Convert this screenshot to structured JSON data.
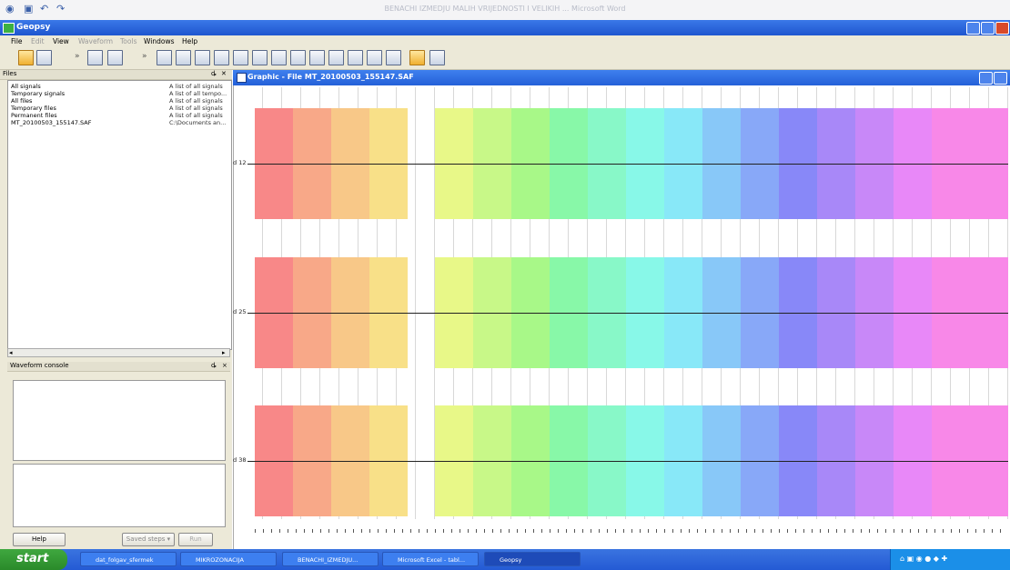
{
  "word_window": {
    "title": "BENACHI IZMEDJU MALIH VRIJEDNOSTI I VELIKIH ... Microsoft Word"
  },
  "geopsy": {
    "title": "Geopsy",
    "menu": [
      "File",
      "Edit",
      "View",
      "Waveform",
      "Tools",
      "Windows",
      "Help"
    ],
    "toolbar_icons": [
      "open-folder-icon",
      "save-icon",
      "table-icon",
      "view-icon",
      "graphic-icon",
      "map-icon",
      "chart-icon",
      "grid-icon",
      "signal-icon",
      "spectrum-icon",
      "filter-icon",
      "rotate-icon",
      "pick-icon",
      "fk-icon",
      "hv-icon",
      "structure-icon",
      "orange-icon",
      "export-icon"
    ]
  },
  "files_panel": {
    "title": "Files",
    "rows": [
      {
        "name": "All signals",
        "desc": "A list of all signals"
      },
      {
        "name": "Temporary signals",
        "desc": "A list of all tempo..."
      },
      {
        "name": "All files",
        "desc": "A list of all signals"
      },
      {
        "name": "Temporary files",
        "desc": "A list of all signals"
      },
      {
        "name": "Permanent files",
        "desc": "A list of all signals"
      },
      {
        "name": "MT_20100503_155147.SAF",
        "desc": "C:\\Documents an..."
      }
    ]
  },
  "waveform_console": {
    "title": "Waveform console",
    "help_label": "Help",
    "saved_label": "Saved steps",
    "run_label": "Run"
  },
  "graphic_window": {
    "title": "Graphic - File MT_20100503_155147.SAF",
    "traces": [
      {
        "label": "d 12"
      },
      {
        "label": "d 25"
      },
      {
        "label": "d 38"
      }
    ]
  },
  "taskbar": {
    "start": "start",
    "tasks": [
      {
        "label": "dat_folgav_sfermek"
      },
      {
        "label": "MIKROZONACIJA"
      },
      {
        "label": "BENACHI_IZMEDJU..."
      },
      {
        "label": "Microsoft Excel - tabl..."
      },
      {
        "label": "Geopsy"
      }
    ]
  },
  "colors": {
    "spectrum": [
      "#f88888",
      "#f8a888",
      "#f8c888",
      "#f8e088",
      "#e8f888",
      "#c8f888",
      "#a8f888",
      "#88f8a8",
      "#88f8c8",
      "#88f8e8",
      "#88e8f8",
      "#88c8f8",
      "#88a8f8",
      "#8888f8",
      "#a888f8",
      "#c888f8",
      "#e888f8",
      "#f888e8"
    ],
    "titlebar": "#2460d8",
    "taskbar": "#245ad4"
  }
}
